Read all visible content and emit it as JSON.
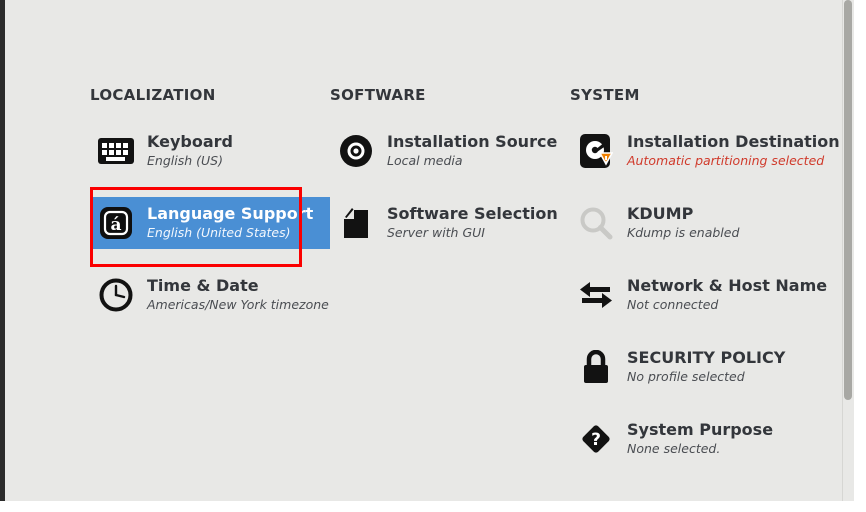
{
  "window": {
    "background": "#e8e8e6",
    "accent_selected": "#4a8fd4",
    "annotation_color": "#fb0000",
    "warning_text_color": "#d03a2b"
  },
  "scrollbar": {
    "name": "vertical-scrollbar",
    "thumb_position": "top"
  },
  "columns": [
    {
      "id": "localization",
      "title": "LOCALIZATION",
      "items": [
        {
          "id": "keyboard",
          "icon": "keyboard-icon",
          "title": "Keyboard",
          "subtitle": "English (US)",
          "selected": false,
          "warning": false
        },
        {
          "id": "language-support",
          "icon": "language-support-icon",
          "title": "Language Support",
          "subtitle": "English (United States)",
          "selected": true,
          "warning": false,
          "annotated": true
        },
        {
          "id": "time-and-date",
          "icon": "clock-icon",
          "title": "Time & Date",
          "subtitle": "Americas/New York timezone",
          "selected": false,
          "warning": false
        }
      ]
    },
    {
      "id": "software",
      "title": "SOFTWARE",
      "items": [
        {
          "id": "installation-source",
          "icon": "disc-icon",
          "title": "Installation Source",
          "subtitle": "Local media",
          "selected": false,
          "warning": false
        },
        {
          "id": "software-selection",
          "icon": "package-icon",
          "title": "Software Selection",
          "subtitle": "Server with GUI",
          "selected": false,
          "warning": false
        }
      ]
    },
    {
      "id": "system",
      "title": "SYSTEM",
      "items": [
        {
          "id": "installation-destination",
          "icon": "harddrive-warning-icon",
          "title": "Installation Destination",
          "subtitle": "Automatic partitioning selected",
          "selected": false,
          "warning": true
        },
        {
          "id": "kdump",
          "icon": "magnifier-icon",
          "title": "KDUMP",
          "subtitle": "Kdump is enabled",
          "selected": false,
          "warning": false
        },
        {
          "id": "network-and-host-name",
          "icon": "network-arrows-icon",
          "title": "Network & Host Name",
          "subtitle": "Not connected",
          "selected": false,
          "warning": false
        },
        {
          "id": "security-policy",
          "icon": "lock-icon",
          "title": "SECURITY POLICY",
          "subtitle": "No profile selected",
          "selected": false,
          "warning": false
        },
        {
          "id": "system-purpose",
          "icon": "question-diamond-icon",
          "title": "System Purpose",
          "subtitle": "None selected.",
          "selected": false,
          "warning": false
        }
      ]
    }
  ]
}
